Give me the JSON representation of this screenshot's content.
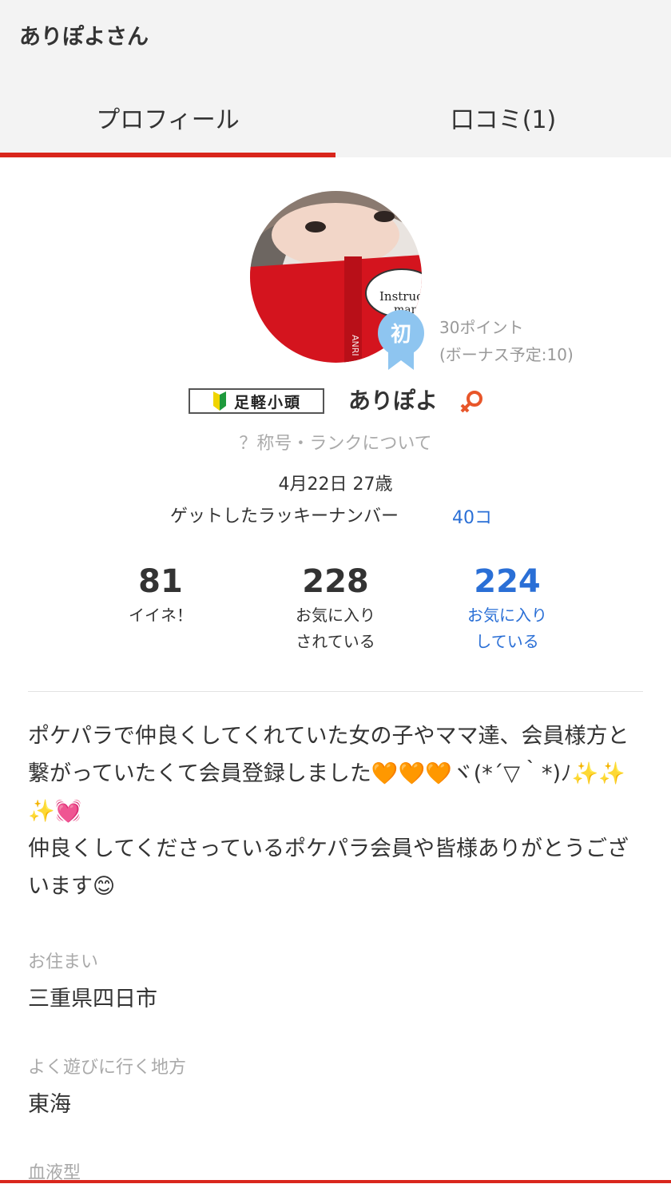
{
  "header": {
    "title": "ありぽよさん"
  },
  "tabs": [
    {
      "label": "プロフィール",
      "active": true
    },
    {
      "label": "口コミ(1)",
      "active": false
    }
  ],
  "profile": {
    "avatar_icon": "user-avatar-photo",
    "badge_char": "初",
    "points": "30ポイント",
    "bonus": "(ボーナス予定:10)",
    "title_badge": "足軽小頭",
    "username": "ありぽよ",
    "gender_icon": "female-symbol-icon",
    "rank_link": "？称号・ランクについて",
    "birthday": "4月22日 27歳",
    "lucky_label": "ゲットしたラッキーナンバー",
    "lucky_count": "40コ"
  },
  "stats": [
    {
      "value": "81",
      "label": "イイネ！"
    },
    {
      "value": "228",
      "label": "お気に入り\nされている"
    },
    {
      "value": "224",
      "label": "お気に入り\nしている"
    }
  ],
  "bio": "ポケパラで仲良くしてくれていた女の子やママ達、会員様方と繋がっていたくて会員登録しました🧡🧡🧡ヾ(*´▽｀*)ﾉ✨✨✨💓\n仲良くしてくださっているポケパラ会員や皆様ありがとうございます😊",
  "fields": [
    {
      "label": "お住まい",
      "value": "三重県四日市"
    },
    {
      "label": "よく遊びに行く地方",
      "value": "東海"
    },
    {
      "label": "血液型",
      "value": ""
    }
  ],
  "colors": {
    "accent": "#d9261c",
    "link": "#2a6fd6",
    "badge": "#8ec5f0",
    "gender": "#e8562a"
  }
}
